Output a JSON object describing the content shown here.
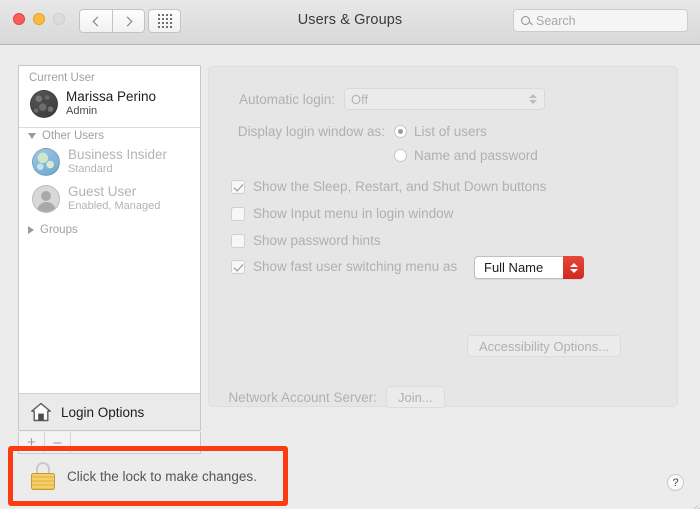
{
  "window": {
    "title": "Users & Groups",
    "traffic_lights": [
      "close",
      "minimize",
      "zoom"
    ],
    "nav": {
      "back": "back-chevron",
      "forward": "forward-chevron",
      "grid": "show-all-grid"
    },
    "search": {
      "placeholder": "Search",
      "value": "",
      "icon": "search-icon"
    }
  },
  "sidebar": {
    "current_user_header": "Current User",
    "current_user": {
      "name": "Marissa Perino",
      "role": "Admin",
      "avatar": "moon-avatar"
    },
    "other_users_header": "Other Users",
    "other_users": [
      {
        "name": "Business Insider",
        "role": "Standard",
        "avatar": "earth-avatar"
      },
      {
        "name": "Guest User",
        "role": "Enabled, Managed",
        "avatar": "person-avatar"
      }
    ],
    "groups_header": "Groups",
    "login_options": {
      "label": "Login Options",
      "icon": "home-icon"
    },
    "add_label": "+",
    "remove_label": "–"
  },
  "main": {
    "automatic_login": {
      "label": "Automatic login:",
      "value": "Off"
    },
    "display_login_window": {
      "label": "Display login window as:",
      "options": [
        "List of users",
        "Name and password"
      ],
      "selected": "List of users"
    },
    "checkboxes": [
      {
        "label": "Show the Sleep, Restart, and Shut Down buttons",
        "checked": true
      },
      {
        "label": "Show Input menu in login window",
        "checked": false
      },
      {
        "label": "Show password hints",
        "checked": false
      },
      {
        "label": "Show fast user switching menu as",
        "checked": true
      }
    ],
    "fast_user_switching_value": "Full Name",
    "accessibility_button": "Accessibility Options...",
    "network_account_server": {
      "label": "Network Account Server:",
      "button": "Join..."
    }
  },
  "footer": {
    "lock_text": "Click the lock to make changes.",
    "lock_icon": "closed-padlock-icon",
    "help_label": "?"
  },
  "annotation": {
    "highlight_color": "#fa3c12"
  }
}
